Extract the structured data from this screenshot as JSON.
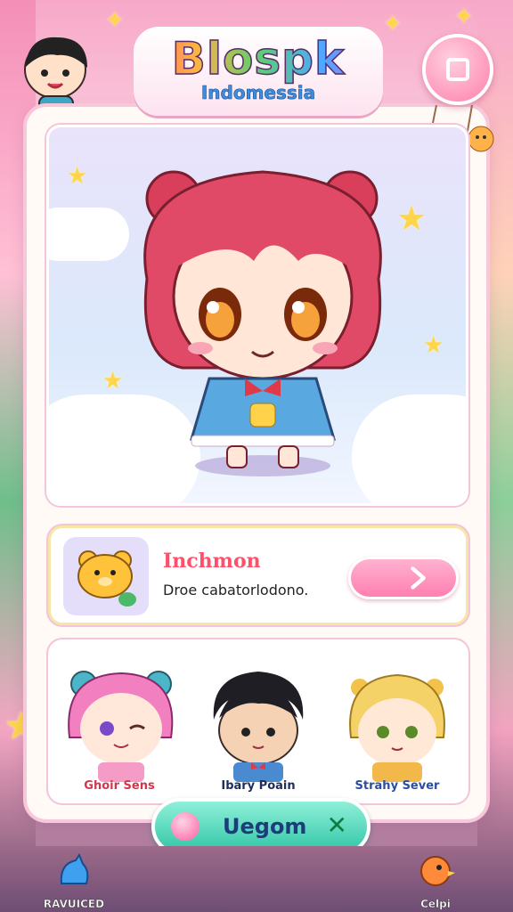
{
  "header": {
    "logo_title": "Blospk",
    "logo_subtitle": "Indomessia"
  },
  "menu_button": {
    "icon": "square-menu-icon"
  },
  "featured": {
    "title": "Inchmon",
    "description": "Droe cabatorlodono.",
    "go_icon": "chevron-right-icon"
  },
  "characters": [
    {
      "name": "Ghoir Sens",
      "name_color": "#d1364d"
    },
    {
      "name": "Ibary Poain",
      "name_color": "#1c2e5c"
    },
    {
      "name": "Strahy Sever",
      "name_color": "#2a4ea0"
    }
  ],
  "start_button": {
    "label": "Uegom",
    "close_icon": "x-icon"
  },
  "bottom_nav": [
    {
      "label": "RAVUICED",
      "icon": "blue-figure-icon"
    },
    {
      "label": "Celpi",
      "icon": "orange-bird-icon"
    }
  ],
  "colors": {
    "accent_pink": "#ff7fab",
    "accent_teal": "#33c6a8",
    "title_red": "#ff4f6b"
  }
}
